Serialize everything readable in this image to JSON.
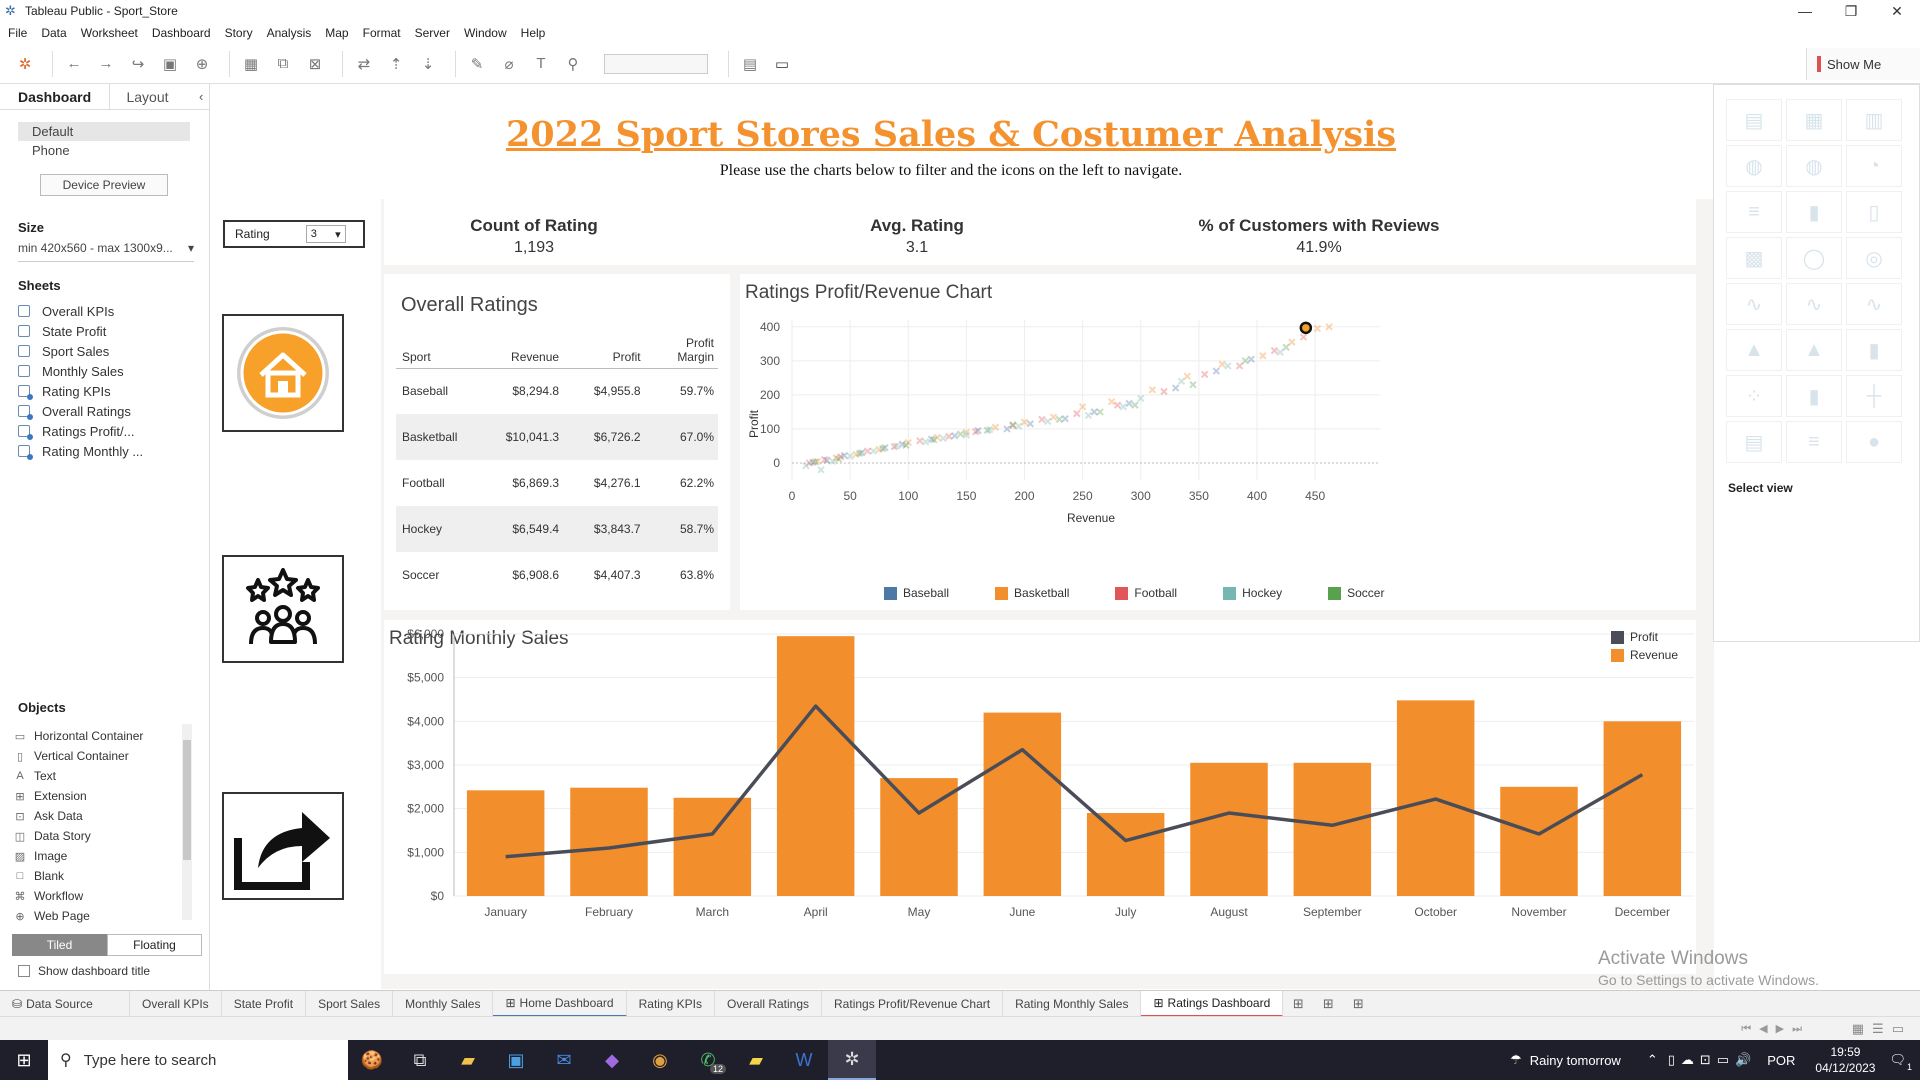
{
  "window": {
    "title": "Tableau Public - Sport_Store"
  },
  "menu": [
    "File",
    "Data",
    "Worksheet",
    "Dashboard",
    "Story",
    "Analysis",
    "Map",
    "Format",
    "Server",
    "Window",
    "Help"
  ],
  "toolbar": {
    "show_me": "Show Me"
  },
  "left_pane": {
    "tab_dashboard": "Dashboard",
    "tab_layout": "Layout",
    "device_default": "Default",
    "device_phone": "Phone",
    "device_preview": "Device Preview",
    "size_head": "Size",
    "size_value": "min 420x560 - max 1300x9...",
    "sheets_head": "Sheets",
    "sheets": [
      "Overall KPIs",
      "State Profit",
      "Sport Sales",
      "Monthly Sales",
      "Rating KPIs",
      "Overall Ratings",
      "Ratings Profit/...",
      "Rating Monthly ..."
    ],
    "objects_head": "Objects",
    "objects": [
      {
        "label": "Horizontal Container",
        "icon": "horizontal-container-icon"
      },
      {
        "label": "Vertical Container",
        "icon": "vertical-container-icon"
      },
      {
        "label": "Text",
        "icon": "text-icon"
      },
      {
        "label": "Extension",
        "icon": "extension-icon"
      },
      {
        "label": "Ask Data",
        "icon": "ask-data-icon"
      },
      {
        "label": "Data Story",
        "icon": "data-story-icon"
      },
      {
        "label": "Image",
        "icon": "image-icon"
      },
      {
        "label": "Blank",
        "icon": "blank-icon"
      },
      {
        "label": "Workflow",
        "icon": "workflow-icon"
      },
      {
        "label": "Web Page",
        "icon": "web-page-icon"
      }
    ],
    "tiled": "Tiled",
    "floating": "Floating",
    "show_title": "Show dashboard title"
  },
  "dashboard": {
    "title": "2022 Sport Stores Sales & Costumer Analysis",
    "subtitle": "Please use the charts below to filter and the icons on the left to navigate.",
    "rating_filter": {
      "label": "Rating",
      "value": "3"
    },
    "kpis": [
      {
        "label": "Count of Rating",
        "value": "1,193"
      },
      {
        "label": "Avg. Rating",
        "value": "3.1"
      },
      {
        "label": "% of Customers with Reviews",
        "value": "41.9%"
      }
    ],
    "overall": {
      "title": "Overall Ratings",
      "headers": [
        "Sport",
        "Revenue",
        "Profit",
        "Profit Margin"
      ],
      "rows": [
        [
          "Baseball",
          "$8,294.8",
          "$4,955.8",
          "59.7%"
        ],
        [
          "Basketball",
          "$10,041.3",
          "$6,726.2",
          "67.0%"
        ],
        [
          "Football",
          "$6,869.3",
          "$4,276.1",
          "62.2%"
        ],
        [
          "Hockey",
          "$6,549.4",
          "$3,843.7",
          "58.7%"
        ],
        [
          "Soccer",
          "$6,908.6",
          "$4,407.3",
          "63.8%"
        ]
      ]
    }
  },
  "chart_data": [
    {
      "type": "scatter",
      "title": "Ratings Profit/Revenue Chart",
      "xlabel": "Revenue",
      "ylabel": "Profit",
      "xlim": [
        0,
        480
      ],
      "ylim": [
        -50,
        420
      ],
      "xticks": [
        0,
        50,
        100,
        150,
        200,
        250,
        300,
        350,
        400,
        450
      ],
      "yticks": [
        0,
        100,
        200,
        300,
        400
      ],
      "legend": "bottom",
      "series": [
        {
          "name": "Baseball",
          "color": "#4e79a7",
          "points": [
            [
              18,
              2
            ],
            [
              30,
              8
            ],
            [
              45,
              22
            ],
            [
              60,
              30
            ],
            [
              80,
              45
            ],
            [
              95,
              55
            ],
            [
              120,
              70
            ],
            [
              140,
              80
            ],
            [
              160,
              95
            ],
            [
              185,
              100
            ],
            [
              205,
              115
            ],
            [
              235,
              130
            ],
            [
              260,
              150
            ],
            [
              290,
              175
            ],
            [
              330,
              220
            ],
            [
              365,
              270
            ],
            [
              395,
              305
            ]
          ]
        },
        {
          "name": "Basketball",
          "color": "#f28e2b",
          "points": [
            [
              22,
              5
            ],
            [
              38,
              15
            ],
            [
              55,
              25
            ],
            [
              75,
              40
            ],
            [
              100,
              60
            ],
            [
              125,
              75
            ],
            [
              150,
              90
            ],
            [
              175,
              105
            ],
            [
              200,
              120
            ],
            [
              225,
              135
            ],
            [
              250,
              165
            ],
            [
              275,
              180
            ],
            [
              310,
              215
            ],
            [
              340,
              255
            ],
            [
              370,
              290
            ],
            [
              405,
              315
            ],
            [
              430,
              355
            ],
            [
              452,
              395
            ],
            [
              462,
              400
            ]
          ]
        },
        {
          "name": "Football",
          "color": "#e15759",
          "points": [
            [
              15,
              0
            ],
            [
              28,
              10
            ],
            [
              42,
              18
            ],
            [
              65,
              35
            ],
            [
              88,
              48
            ],
            [
              110,
              65
            ],
            [
              135,
              78
            ],
            [
              158,
              92
            ],
            [
              190,
              110
            ],
            [
              215,
              128
            ],
            [
              245,
              145
            ],
            [
              280,
              170
            ],
            [
              320,
              210
            ],
            [
              355,
              260
            ],
            [
              385,
              285
            ],
            [
              415,
              330
            ],
            [
              440,
              370
            ]
          ]
        },
        {
          "name": "Hockey",
          "color": "#76b7b2",
          "points": [
            [
              12,
              -8
            ],
            [
              25,
              -20
            ],
            [
              35,
              5
            ],
            [
              50,
              20
            ],
            [
              70,
              35
            ],
            [
              90,
              50
            ],
            [
              115,
              62
            ],
            [
              130,
              72
            ],
            [
              150,
              82
            ],
            [
              170,
              98
            ],
            [
              195,
              108
            ],
            [
              220,
              122
            ],
            [
              255,
              140
            ],
            [
              285,
              165
            ],
            [
              300,
              190
            ],
            [
              335,
              240
            ],
            [
              375,
              285
            ],
            [
              420,
              325
            ]
          ]
        },
        {
          "name": "Soccer",
          "color": "#59a14f",
          "points": [
            [
              20,
              3
            ],
            [
              40,
              12
            ],
            [
              58,
              28
            ],
            [
              78,
              42
            ],
            [
              98,
              52
            ],
            [
              122,
              68
            ],
            [
              145,
              85
            ],
            [
              168,
              96
            ],
            [
              190,
              112
            ],
            [
              230,
              128
            ],
            [
              265,
              150
            ],
            [
              295,
              170
            ],
            [
              345,
              230
            ],
            [
              390,
              300
            ],
            [
              425,
              340
            ]
          ]
        }
      ],
      "highlight": {
        "x": 442,
        "y": 397
      }
    },
    {
      "type": "bar",
      "title": "Rating Monthly Sales",
      "categories": [
        "January",
        "February",
        "March",
        "April",
        "May",
        "June",
        "July",
        "August",
        "September",
        "October",
        "November",
        "December"
      ],
      "yticks": [
        "$0",
        "$1,000",
        "$2,000",
        "$3,000",
        "$4,000",
        "$5,000",
        "$6,000"
      ],
      "ylim": [
        0,
        6000
      ],
      "legend": "top-right",
      "series": [
        {
          "name": "Profit",
          "type": "line",
          "color": "#4a4d57",
          "values": [
            900,
            1100,
            1420,
            4350,
            1900,
            3350,
            1270,
            1900,
            1620,
            2220,
            1420,
            2780
          ]
        },
        {
          "name": "Revenue",
          "type": "bar",
          "color": "#f28e2b",
          "values": [
            2420,
            2480,
            2250,
            5950,
            2700,
            4200,
            1900,
            3050,
            3050,
            4480,
            2500,
            4000
          ]
        }
      ]
    }
  ],
  "sheet_tabs": [
    {
      "label": "Data Source",
      "icon": "database-icon"
    },
    {
      "label": "Overall KPIs"
    },
    {
      "label": "State Profit"
    },
    {
      "label": "Sport Sales"
    },
    {
      "label": "Monthly Sales"
    },
    {
      "label": "Home Dashboard",
      "icon": "dashboard-icon",
      "state": "home"
    },
    {
      "label": "Rating KPIs"
    },
    {
      "label": "Overall Ratings"
    },
    {
      "label": "Ratings Profit/Revenue Chart"
    },
    {
      "label": "Rating Monthly Sales"
    },
    {
      "label": "Ratings Dashboard",
      "icon": "dashboard-icon",
      "state": "active"
    }
  ],
  "showme": {
    "select_view": "Select view"
  },
  "watermark": {
    "line1": "Activate Windows",
    "line2": "Go to Settings to activate Windows."
  },
  "taskbar": {
    "search_placeholder": "Type here to search",
    "weather": "Rainy tomorrow",
    "lang": "POR",
    "time": "19:59",
    "date": "04/12/2023",
    "whatsapp_badge": "12",
    "notif_badge": "1"
  }
}
